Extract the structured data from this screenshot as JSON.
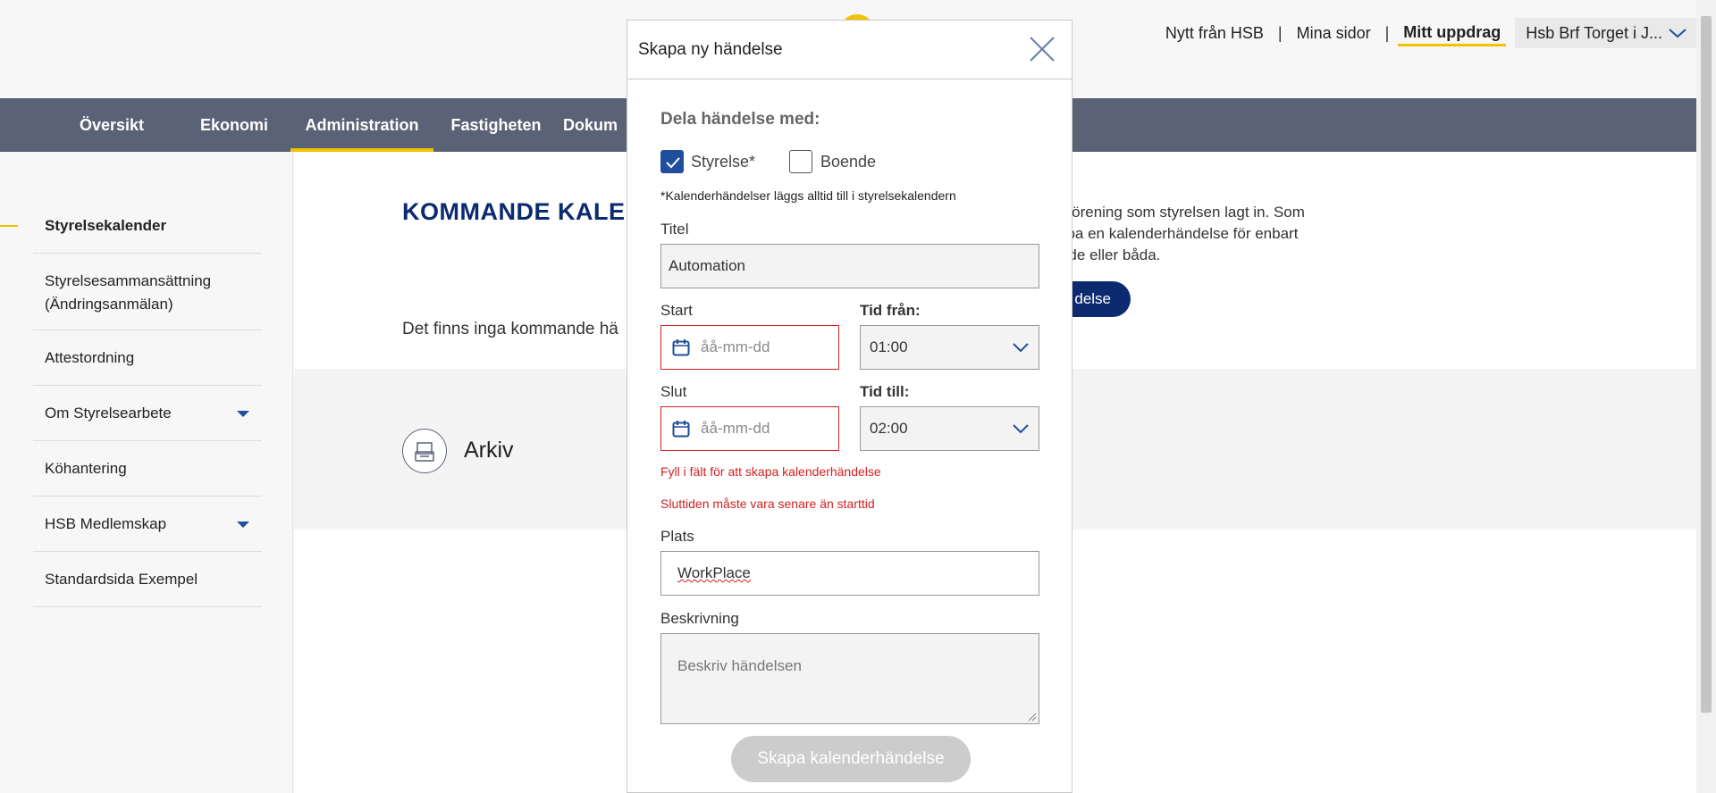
{
  "header": {
    "links": [
      "Nytt från HSB",
      "Mina sidor",
      "Mitt uppdrag"
    ],
    "active_link": "Mitt uppdrag",
    "org_selector": "Hsb Brf Torget i J..."
  },
  "nav": {
    "items": [
      "Översikt",
      "Ekonomi",
      "Administration",
      "Fastigheten",
      "Dokum"
    ],
    "active": "Administration"
  },
  "sidebar": {
    "items": [
      {
        "label": "Styrelsekalender"
      },
      {
        "label": "Styrelsesammansättning",
        "label2": "(Ändringsanmälan)"
      },
      {
        "label": "Attestordning"
      },
      {
        "label": "Om Styrelsearbete"
      },
      {
        "label": "Köhantering"
      },
      {
        "label": "HSB Medlemskap"
      },
      {
        "label": "Standardsida Exempel"
      }
    ]
  },
  "content": {
    "title": "KOMMANDE KALE",
    "description_lines": [
      "din förening som styrelsen lagt in. Som",
      " skapa en kalenderhändelse för enbart",
      "pende eller båda."
    ],
    "button_label": "delse",
    "empty_text": "Det finns inga kommande hä",
    "archive_label": "Arkiv"
  },
  "dialog": {
    "title": "Skapa ny händelse",
    "share_label": "Dela händelse med:",
    "checkbox_styrelse": "Styrelse*",
    "checkbox_boende": "Boende",
    "note": "*Kalenderhändelser läggs alltid till i styrelsekalendern",
    "title_label": "Titel",
    "title_value": "Automation",
    "start_label": "Start",
    "start_placeholder": "åå-mm-dd",
    "time_from_label": "Tid från:",
    "time_from_value": "01:00",
    "end_label": "Slut",
    "end_placeholder": "åå-mm-dd",
    "time_to_label": "Tid till:",
    "time_to_value": "02:00",
    "error_1": "Fyll i fält för att skapa kalenderhändelse",
    "error_2": "Sluttiden måste vara senare än starttid",
    "place_label": "Plats",
    "place_value": "WorkPlace",
    "desc_label": "Beskrivning",
    "desc_placeholder": "Beskriv händelsen",
    "submit_label": "Skapa kalenderhändelse"
  },
  "colors": {
    "accent_yellow": "#f2c200",
    "nav_bg": "#5a6275",
    "brand_blue": "#0b2a6f",
    "error_red": "#d32020",
    "checkbox_blue": "#1f4e9c"
  }
}
